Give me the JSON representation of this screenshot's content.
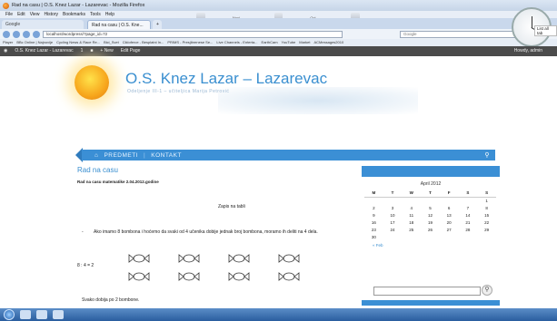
{
  "browser": {
    "window_title": "Rad na casu | O.S. Knez Lazar - Lazarevac - Mozilla Firefox",
    "menu": [
      "File",
      "Edit",
      "View",
      "History",
      "Bookmarks",
      "Tools",
      "Help"
    ],
    "tabs": [
      {
        "label": "Google"
      },
      {
        "label": "Rad na casu | O.S. Kne..."
      }
    ],
    "url": "localhost/wordpress/?page_id=72",
    "search_placeholder": "Google",
    "bookmarks": [
      "Player",
      "BBc Online | Najnovije",
      "Cycling News & Race Re...",
      "Bici_Svet",
      "Cikloferce - Besplatni In...",
      "PRIMS - Presjibrenese Se...",
      "Live Channels - Enterta...",
      "EarthCam",
      "YouTube",
      "Market",
      "ACMessages2010"
    ],
    "list_all_tabs": "List all tab",
    "taskbar_labels": [
      "Novi folder",
      "Ovi Photo",
      "Photo"
    ]
  },
  "adminbar": {
    "site": "O.S. Knez Lazar - Lazarevac",
    "updates": "1",
    "new": "+ New",
    "edit": "Edit Page",
    "howdy": "Howdy, admin"
  },
  "site": {
    "title": "O.S. Knez Lazar – Lazarevac",
    "description": "Odeljenje III-1 – učiteljica Marija Petrović"
  },
  "nav": {
    "items": [
      "PREDMETI",
      "KONTAKT"
    ]
  },
  "post": {
    "title": "Rad na casu",
    "subtitle": "Rad na casu matematike 2.04.2012.godine",
    "zapis": "Zapis na tabli",
    "bullet": "Ako imamo 8 bombona i hoćemo da svaki  od 4 učenika dobije jednak broj bombona, moramo ih deliti na 4 dela.",
    "equation": "8 : 4 = 2",
    "conclusion": "Svako dobija po 2 bombone."
  },
  "calendar": {
    "title": "April 2012",
    "weekdays": [
      "M",
      "T",
      "W",
      "T",
      "F",
      "S",
      "S"
    ],
    "weeks": [
      [
        "",
        "",
        "",
        "",
        "",
        "",
        "1"
      ],
      [
        "2",
        "3",
        "4",
        "5",
        "6",
        "7",
        "8"
      ],
      [
        "9",
        "10",
        "11",
        "12",
        "13",
        "14",
        "15"
      ],
      [
        "16",
        "17",
        "18",
        "19",
        "20",
        "21",
        "22"
      ],
      [
        "23",
        "24",
        "25",
        "26",
        "27",
        "28",
        "29"
      ],
      [
        "30",
        "",
        "",
        "",
        "",
        "",
        ""
      ]
    ],
    "prev_link": "« Feb"
  },
  "colors": {
    "accent": "#3b8fd5",
    "adminbar": "#4b4b4b",
    "title": "#3a8fd0"
  }
}
